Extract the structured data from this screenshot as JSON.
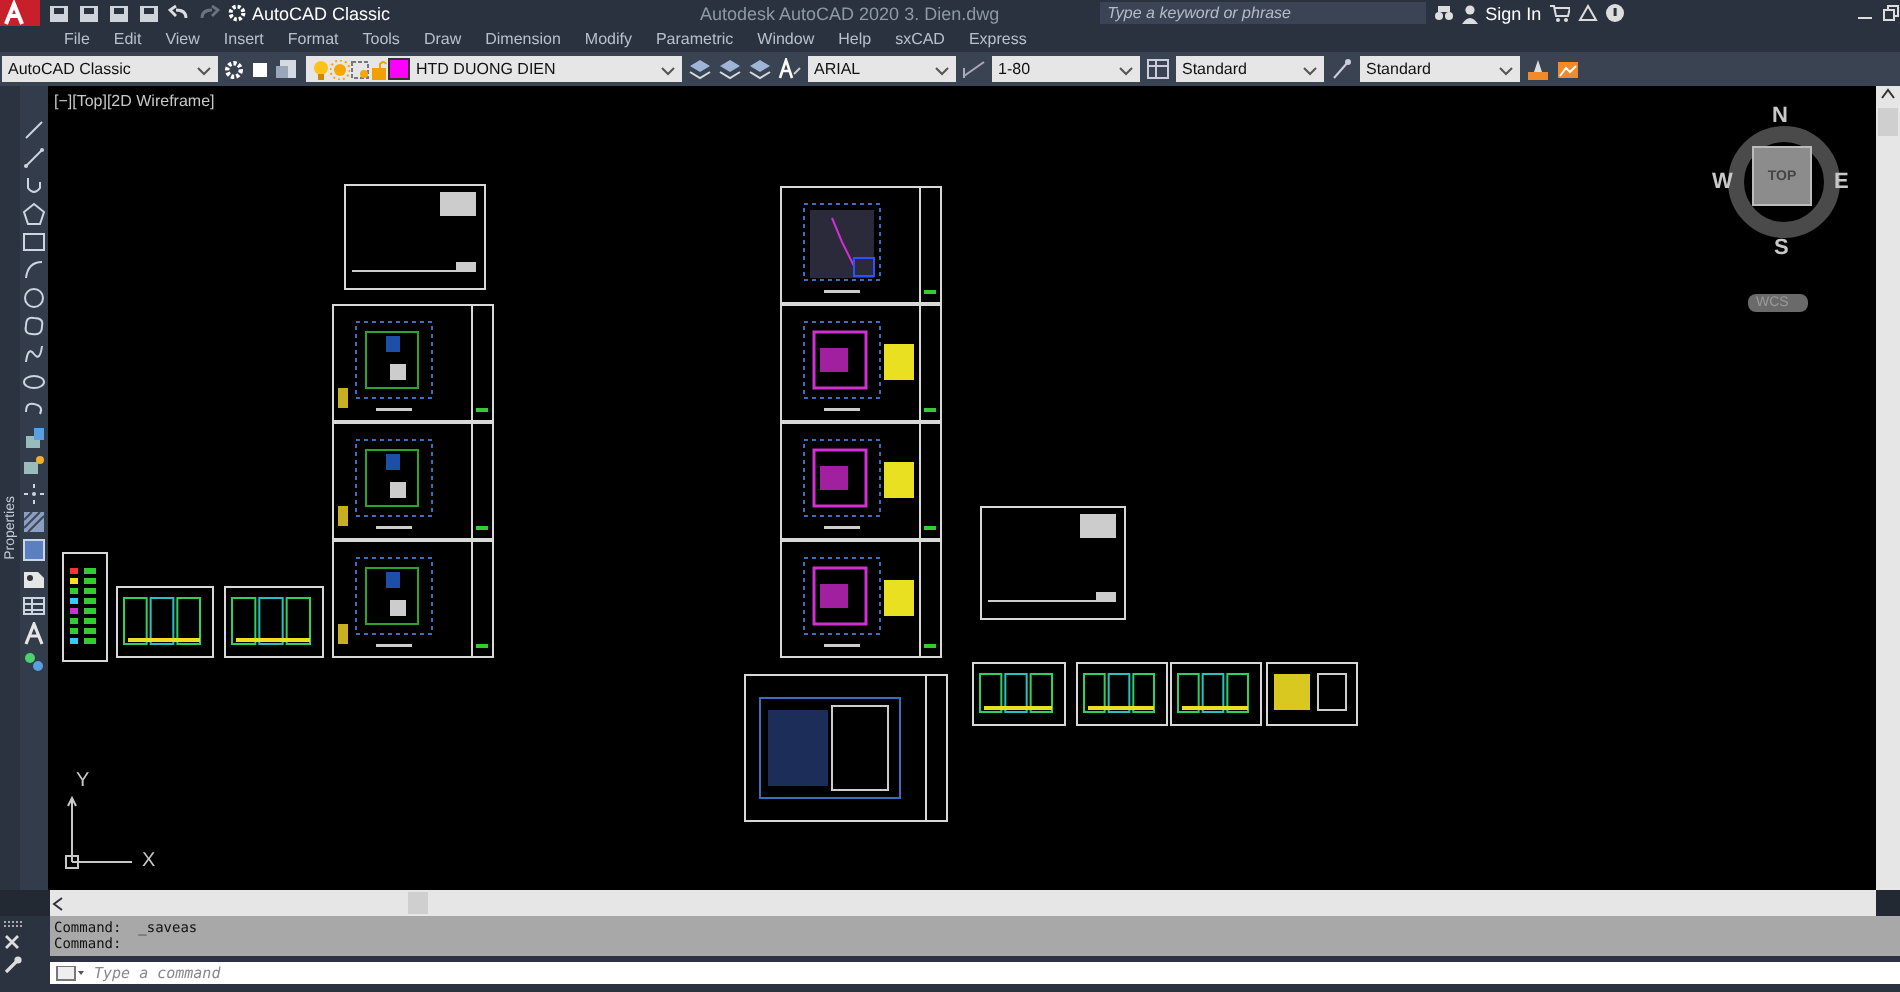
{
  "title_bar": {
    "workspace": "AutoCAD Classic",
    "app_title": "Autodesk AutoCAD 2020",
    "file_name": "3. Dien.dwg",
    "search": {
      "placeholder": "Type a keyword or phrase"
    },
    "sign_in": "Sign In"
  },
  "menu": [
    "File",
    "Edit",
    "View",
    "Insert",
    "Format",
    "Tools",
    "Draw",
    "Dimension",
    "Modify",
    "Parametric",
    "Window",
    "Help",
    "sxCAD",
    "Express"
  ],
  "toolbar": {
    "workspace": "AutoCAD Classic",
    "layer": {
      "name": "HTD DUONG DIEN",
      "color": "#ff00ff"
    },
    "text_style": "ARIAL",
    "dim_scale": "1-80",
    "table_style": "Standard",
    "multileader_style": "Standard"
  },
  "side_palette": {
    "title": "Properties"
  },
  "viewport": {
    "label": "[−][Top][2D Wireframe]",
    "viewcube": {
      "north": "N",
      "south": "S",
      "east": "E",
      "west": "W",
      "face": "TOP",
      "coords": "WCS"
    },
    "ucs": {
      "x": "X",
      "y": "Y"
    }
  },
  "command": {
    "history": [
      "Command:  _saveas",
      "Command:"
    ],
    "input": {
      "placeholder": "Type a command"
    }
  }
}
